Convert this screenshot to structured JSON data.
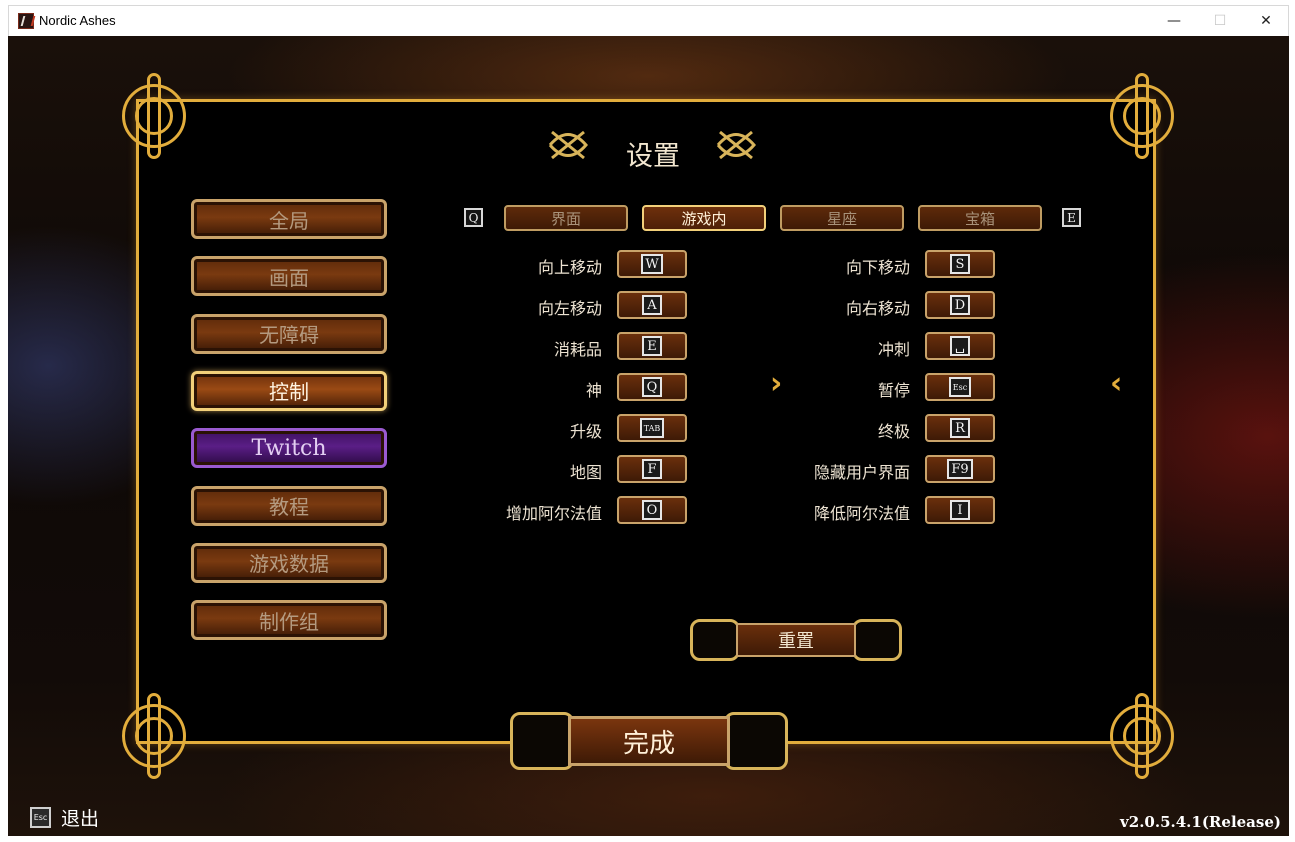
{
  "window": {
    "title": "Nordic Ashes",
    "min_glyph": "—",
    "max_glyph": "☐",
    "close_glyph": "✕"
  },
  "settings": {
    "title": "设置",
    "sidebar": [
      {
        "label": "全局",
        "state": "normal"
      },
      {
        "label": "画面",
        "state": "normal"
      },
      {
        "label": "无障碍",
        "state": "normal"
      },
      {
        "label": "控制",
        "state": "active"
      },
      {
        "label": "Twitch",
        "state": "twitch"
      },
      {
        "label": "教程",
        "state": "normal"
      },
      {
        "label": "游戏数据",
        "state": "normal"
      },
      {
        "label": "制作组",
        "state": "normal"
      }
    ],
    "tabs": {
      "prev_key": "Q",
      "next_key": "E",
      "items": [
        {
          "label": "界面",
          "active": false
        },
        {
          "label": "游戏内",
          "active": true
        },
        {
          "label": "星座",
          "active": false
        },
        {
          "label": "宝箱",
          "active": false
        }
      ]
    },
    "bindings_left": [
      {
        "action": "向上移动",
        "key": "W"
      },
      {
        "action": "向左移动",
        "key": "A"
      },
      {
        "action": "消耗品",
        "key": "E"
      },
      {
        "action": "神",
        "key": "Q"
      },
      {
        "action": "升级",
        "key": "TAB"
      },
      {
        "action": "地图",
        "key": "F"
      },
      {
        "action": "增加阿尔法值",
        "key": "O"
      }
    ],
    "bindings_right": [
      {
        "action": "向下移动",
        "key": "S"
      },
      {
        "action": "向右移动",
        "key": "D"
      },
      {
        "action": "冲刺",
        "key": "␣"
      },
      {
        "action": "暂停",
        "key": "Esc"
      },
      {
        "action": "终极",
        "key": "R"
      },
      {
        "action": "隐藏用户界面",
        "key": "F9"
      },
      {
        "action": "降低阿尔法值",
        "key": "I"
      }
    ],
    "page_next_glyph": "›",
    "page_prev_glyph": "‹",
    "reset_label": "重置",
    "done_label": "完成"
  },
  "footer": {
    "exit_key": "Esc",
    "exit_label": "退出",
    "version": "v2.0.5.4.1(Release)"
  },
  "colors": {
    "gold": "#e2ad3c",
    "brown": "#6a2f0c",
    "twitch": "#5a1e86"
  },
  "icons": [
    "app-icon",
    "celtic-knot-icon",
    "chevron-right-icon",
    "chevron-left-icon",
    "esc-key-icon"
  ]
}
